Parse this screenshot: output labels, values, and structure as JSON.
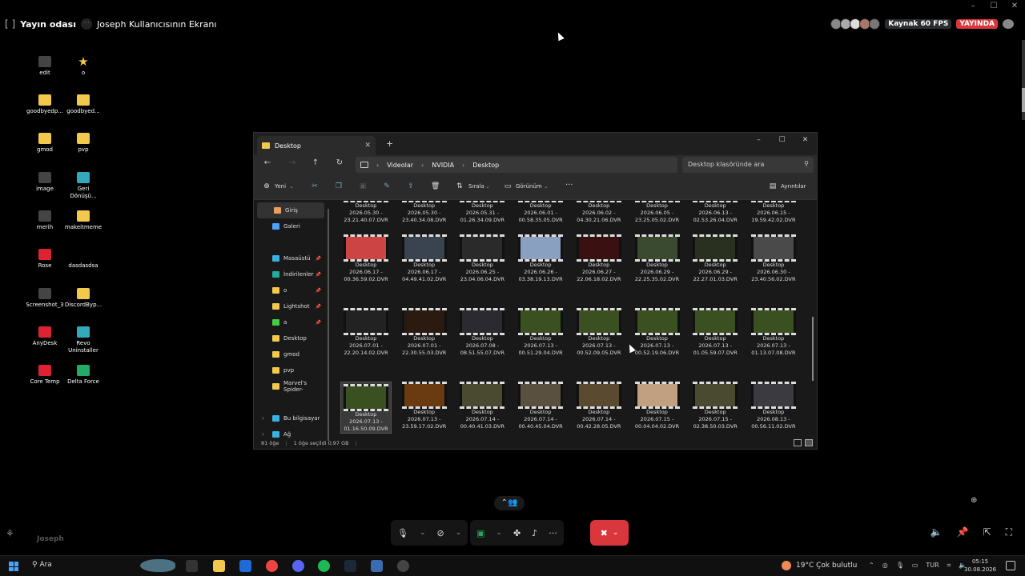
{
  "discord": {
    "room_name": "Yayın odası",
    "screen_title": "Joseph Kullanıcısının Ekranı",
    "source_badge": "Kaynak 60 FPS",
    "live_badge": "YAYINDA",
    "user_label": "Joseph"
  },
  "desktop_icons": [
    {
      "label": "edit",
      "icon": "edit-icon",
      "color": "dark"
    },
    {
      "label": "o",
      "icon": "star-icon",
      "color": "star"
    },
    {
      "label": "goodbyedp...",
      "icon": "folder-icon",
      "color": "folder"
    },
    {
      "label": "goodbyed...",
      "icon": "folder-icon",
      "color": "folder"
    },
    {
      "label": "gmod",
      "icon": "folder-icon",
      "color": "folder"
    },
    {
      "label": "pvp",
      "icon": "folder-icon",
      "color": "folder"
    },
    {
      "label": "image",
      "icon": "image-icon",
      "color": "dark"
    },
    {
      "label": "Geri Dönüşü...",
      "icon": "recycle-bin-icon",
      "color": "teal"
    },
    {
      "label": "merih",
      "icon": "image-icon",
      "color": "dark"
    },
    {
      "label": "makeitmeme",
      "icon": "folder-icon",
      "color": "folder"
    },
    {
      "label": "Rose",
      "icon": "rose-icon",
      "color": "red"
    },
    {
      "label": "dasdasdsa",
      "icon": "blank-icon",
      "color": "none"
    },
    {
      "label": "Screenshot_3",
      "icon": "image-icon",
      "color": "dark"
    },
    {
      "label": "DiscordByp...",
      "icon": "folder-icon",
      "color": "folder"
    },
    {
      "label": "AnyDesk",
      "icon": "anydesk-icon",
      "color": "red"
    },
    {
      "label": "Revo Uninstaller",
      "icon": "revo-icon",
      "color": "teal"
    },
    {
      "label": "Core Temp",
      "icon": "core-temp-icon",
      "color": "red"
    },
    {
      "label": "Delta Force",
      "icon": "delta-force-icon",
      "color": "green"
    }
  ],
  "explorer": {
    "tab_title": "Desktop",
    "breadcrumb": [
      "Videolar",
      "NVIDIA",
      "Desktop"
    ],
    "search_placeholder": "Desktop klasöründe ara",
    "toolbar": {
      "new": "Yeni",
      "sort": "Sırala",
      "view": "Görünüm",
      "details": "Ayrıntılar"
    },
    "sidebar": [
      {
        "label": "Giriş",
        "icon": "home-icon",
        "color": "#e8a060",
        "selected": true
      },
      {
        "label": "Galeri",
        "icon": "gallery-icon",
        "color": "#4aa3ff"
      },
      {
        "label": "Masaüstü",
        "icon": "desktop-icon",
        "color": "#3ab0e0",
        "pin": true
      },
      {
        "label": "İndirilenler",
        "icon": "download-icon",
        "color": "#2a9",
        "pin": true
      },
      {
        "label": "o",
        "icon": "star-icon",
        "color": "#f2c94c",
        "pin": true
      },
      {
        "label": "Lightshot",
        "icon": "folder-icon",
        "color": "#f2c94c",
        "pin": true
      },
      {
        "label": "a",
        "icon": "plant-icon",
        "color": "#4c4",
        "pin": true
      },
      {
        "label": "Desktop",
        "icon": "folder-icon",
        "color": "#f2c94c"
      },
      {
        "label": "gmod",
        "icon": "folder-icon",
        "color": "#f2c94c"
      },
      {
        "label": "pvp",
        "icon": "folder-icon",
        "color": "#f2c94c"
      },
      {
        "label": "Marvel's Spider-",
        "icon": "folder-icon",
        "color": "#f2c94c"
      },
      {
        "label": "Bu bilgisayar",
        "icon": "pc-icon",
        "color": "#3ab0e0",
        "expand": true
      },
      {
        "label": "Ağ",
        "icon": "network-icon",
        "color": "#3ab0e0",
        "expand": true
      }
    ],
    "files": [
      {
        "name": "Desktop",
        "date": "2026.05.30 -",
        "time": "23.21.40.07.DVR",
        "tone": "#333"
      },
      {
        "name": "Desktop",
        "date": "2026.05.30 -",
        "time": "23.40.34.08.DVR",
        "tone": "#333"
      },
      {
        "name": "Desktop",
        "date": "2026.05.31 -",
        "time": "01.26.34.09.DVR",
        "tone": "#333"
      },
      {
        "name": "Desktop",
        "date": "2026.06.01 -",
        "time": "00.58.35.05.DVR",
        "tone": "#333"
      },
      {
        "name": "Desktop",
        "date": "2026.06.02 -",
        "time": "04.30.21.06.DVR",
        "tone": "#333"
      },
      {
        "name": "Desktop",
        "date": "2026.06.05 -",
        "time": "23.25.05.02.DVR",
        "tone": "#333"
      },
      {
        "name": "Desktop",
        "date": "2026.06.13 -",
        "time": "02.53.26.04.DVR",
        "tone": "#333"
      },
      {
        "name": "Desktop",
        "date": "2026.06.15 -",
        "time": "19.59.42.02.DVR",
        "tone": "#333"
      },
      {
        "name": "Desktop",
        "date": "2026.06.17 -",
        "time": "00.36.59.02.DVR",
        "tone": "#c44"
      },
      {
        "name": "Desktop",
        "date": "2026.06.17 -",
        "time": "04.49.41.02.DVR",
        "tone": "#3a4450"
      },
      {
        "name": "Desktop",
        "date": "2026.06.25 -",
        "time": "23.04.06.04.DVR",
        "tone": "#2a2a2a"
      },
      {
        "name": "Desktop",
        "date": "2026.06.26 -",
        "time": "03.38.19.13.DVR",
        "tone": "#8aa0c0"
      },
      {
        "name": "Desktop",
        "date": "2026.06.27 -",
        "time": "22.06.18.02.DVR",
        "tone": "#3a1010"
      },
      {
        "name": "Desktop",
        "date": "2026.06.29 -",
        "time": "22.25.35.02.DVR",
        "tone": "#3a4a30"
      },
      {
        "name": "Desktop",
        "date": "2026.06.29 -",
        "time": "22.27.01.03.DVR",
        "tone": "#2a3020"
      },
      {
        "name": "Desktop",
        "date": "2026.06.30 -",
        "time": "23.40.56.02.DVR",
        "tone": "#4a4a4a"
      },
      {
        "name": "Desktop",
        "date": "2026.07.01 -",
        "time": "22.20.14.02.DVR",
        "tone": "#222"
      },
      {
        "name": "Desktop",
        "date": "2026.07.01 -",
        "time": "22.30.55.03.DVR",
        "tone": "#2a1a10"
      },
      {
        "name": "Desktop",
        "date": "2026.07.08 -",
        "time": "08.51.55.07.DVR",
        "tone": "#2a2a30"
      },
      {
        "name": "Desktop",
        "date": "2026.07.13 -",
        "time": "00.51.29.04.DVR",
        "tone": "#3a5020"
      },
      {
        "name": "Desktop",
        "date": "2026.07.13 -",
        "time": "00.52.09.05.DVR",
        "tone": "#3a5020"
      },
      {
        "name": "Desktop",
        "date": "2026.07.13 -",
        "time": "00.52.19.06.DVR",
        "tone": "#3a5020"
      },
      {
        "name": "Desktop",
        "date": "2026.07.13 -",
        "time": "01.05.59.07.DVR",
        "tone": "#3a5020"
      },
      {
        "name": "Desktop",
        "date": "2026.07.13 -",
        "time": "01.13.07.08.DVR",
        "tone": "#3a5020"
      },
      {
        "name": "Desktop",
        "date": "2026.07.13 -",
        "time": "01.16.50.09.DVR",
        "tone": "#3a5020",
        "selected": true
      },
      {
        "name": "Desktop",
        "date": "2026.07.13 -",
        "time": "23.59.17.02.DVR",
        "tone": "#6a3a10"
      },
      {
        "name": "Desktop",
        "date": "2026.07.14 -",
        "time": "00.40.41.03.DVR",
        "tone": "#4a4a30"
      },
      {
        "name": "Desktop",
        "date": "2026.07.14 -",
        "time": "00.40.45.04.DVR",
        "tone": "#5a5040"
      },
      {
        "name": "Desktop",
        "date": "2026.07.14 -",
        "time": "00.42.28.05.DVR",
        "tone": "#5a4a30"
      },
      {
        "name": "Desktop",
        "date": "2026.07.15 -",
        "time": "00.04.04.02.DVR",
        "tone": "#c0a080"
      },
      {
        "name": "Desktop",
        "date": "2026.07.15 -",
        "time": "02.38.50.03.DVR",
        "tone": "#4a4a30"
      },
      {
        "name": "Desktop",
        "date": "2026.08.13 -",
        "time": "00.56.11.02.DVR",
        "tone": "#3a3a40"
      }
    ],
    "status": {
      "count": "81 öğe",
      "selection": "1 öğe seçildi  0,97 GB"
    }
  },
  "taskbar": {
    "search": "Ara",
    "weather": "19°C  Çok bulutlu",
    "lang": "TUR",
    "time": "05:15",
    "date": "30.08.2026"
  }
}
